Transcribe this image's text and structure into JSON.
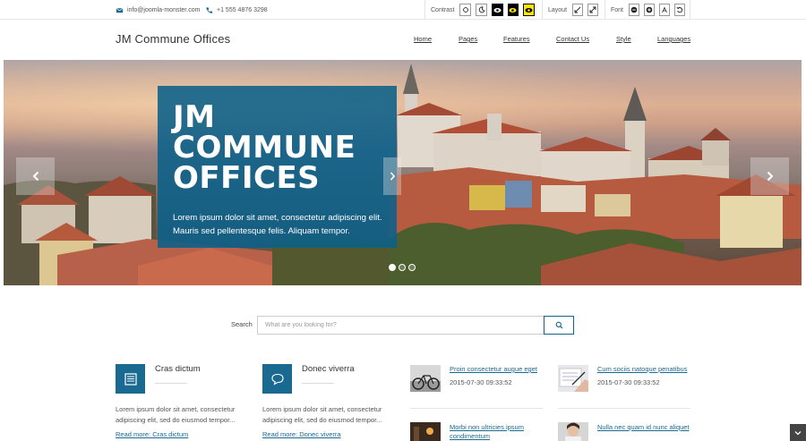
{
  "topbar": {
    "email": "info@joomla-monster.com",
    "phone": "+1 555 4876 3298",
    "contrast_label": "Contrast",
    "layout_label": "Layout",
    "font_label": "Font"
  },
  "header": {
    "site_title": "JM Commune Offices",
    "nav": [
      "Home",
      "Pages",
      "Features",
      "Contact Us",
      "Style",
      "Languages"
    ]
  },
  "hero": {
    "title_lines": [
      "JM",
      "COMMUNE",
      "OFFICES"
    ],
    "description": "Lorem ipsum dolor sit amet, consectetur adipiscing elit. Mauris sed pellentesque felis. Aliquam tempor.",
    "prev_icon": "chevron-left-icon",
    "next_icon": "chevron-right-icon",
    "slide_count": 3,
    "active_slide": 1
  },
  "search": {
    "label": "Search",
    "placeholder": "What are you looking for?",
    "button_icon": "search-icon"
  },
  "features": [
    {
      "title": "Cras dictum",
      "icon": "document-icon",
      "text": "Lorem ipsum dolor sit amet, consectetur adipiscing elit, sed do eiusmod tempor...",
      "link": "Read more: Cras dictum"
    },
    {
      "title": "Donec viverra",
      "icon": "speech-bubble-icon",
      "text": "Lorem ipsum dolor sit amet, consectetur adipiscing elit, sed do eiusmod tempor...",
      "link": "Read more: Donec viverra"
    }
  ],
  "news": [
    {
      "title": "Proin consectetur augue eget",
      "date": "2015-07-30 09:33:52"
    },
    {
      "title": "Cum sociis natoque penatibus",
      "date": "2015-07-30 09:33:52"
    },
    {
      "title": "Morbi non ultricies ipsum condimentum",
      "date": ""
    },
    {
      "title": "Nulla nec quam id nunc aliquet",
      "date": ""
    }
  ],
  "colors": {
    "accent": "#1a6991",
    "caption_bg": "#0a608a",
    "yellow": "#ffe600"
  }
}
